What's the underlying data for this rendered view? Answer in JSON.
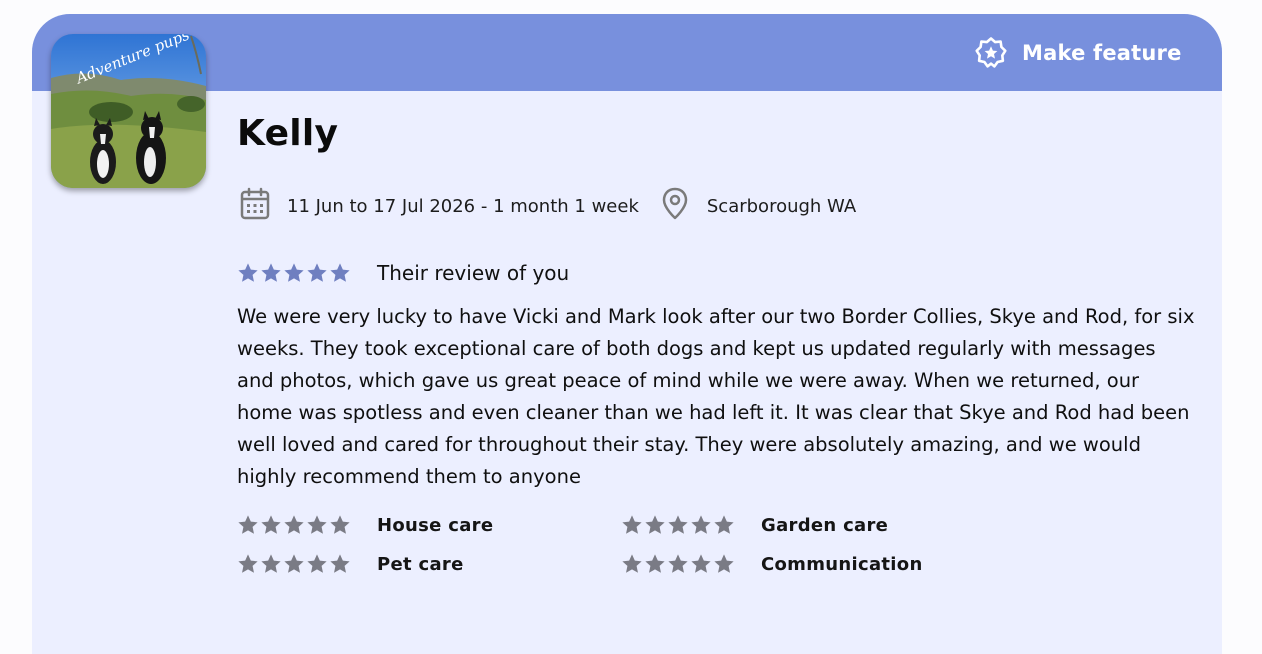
{
  "header": {
    "feature_button_label": "Make feature",
    "feature_icon": "badge-star-icon",
    "background_color": "#7890dd"
  },
  "avatar": {
    "logo_text": "Adventure pups"
  },
  "reviewer": {
    "name": "Kelly"
  },
  "stay": {
    "dates": "11 Jun to 17 Jul 2026 - 1 month 1 week",
    "location": "Scarborough WA",
    "calendar_icon": "calendar-icon",
    "location_icon": "location-pin-icon"
  },
  "review": {
    "heading": "Their review of you",
    "stars": 5,
    "star_color": "#6f7fc0",
    "text": "We were very lucky to have Vicki and Mark look after our two Border Collies, Skye and Rod, for six weeks. They took exceptional care of both dogs and kept us updated regularly with messages and photos, which gave us great peace of mind while we were away. When we returned, our home was spotless and even cleaner than we had left it. It was clear that Skye and Rod had been well loved and cared for throughout their stay. They were absolutely amazing, and we would highly recommend them to anyone"
  },
  "ratings": [
    {
      "label": "House care",
      "stars": 5
    },
    {
      "label": "Garden care",
      "stars": 5
    },
    {
      "label": "Pet care",
      "stars": 5
    },
    {
      "label": "Communication",
      "stars": 5
    }
  ],
  "colors": {
    "card_background": "#ecefff",
    "category_star_color": "#7a7b85"
  }
}
